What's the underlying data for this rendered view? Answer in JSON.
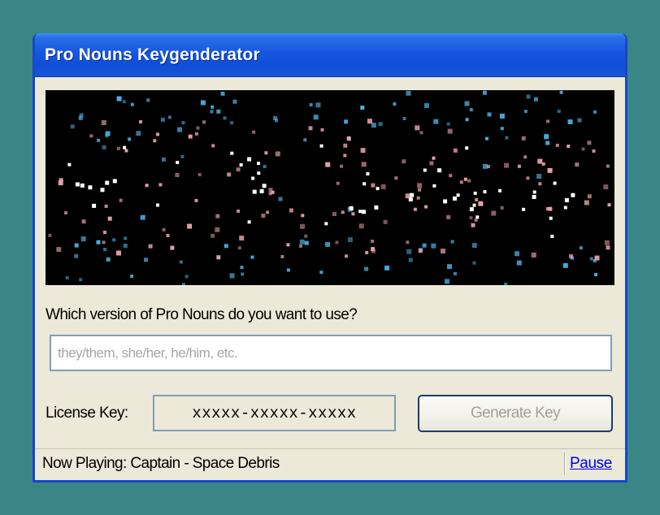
{
  "window": {
    "title": "Pro Nouns Keygenderator"
  },
  "starfield": {
    "colors": {
      "blue": "#4aaee0",
      "pink": "#e8a0a8",
      "white": "#ffffff"
    },
    "background": "#000000"
  },
  "form": {
    "question": "Which version of Pro Nouns do you want to use?",
    "pronoun_value": "",
    "pronoun_placeholder": "they/them, she/her, he/him, etc.",
    "license_label": "License Key:",
    "license_value": "xxxxx-xxxxx-xxxxx",
    "generate_label": "Generate Key"
  },
  "status": {
    "now_playing": "Now Playing: Captain - Space Debris",
    "pause_label": "Pause"
  },
  "colors": {
    "desktop": "#3a8585",
    "title_bar": "#0f4ed8",
    "window_face": "#ece9d8",
    "link": "#0000ee"
  }
}
